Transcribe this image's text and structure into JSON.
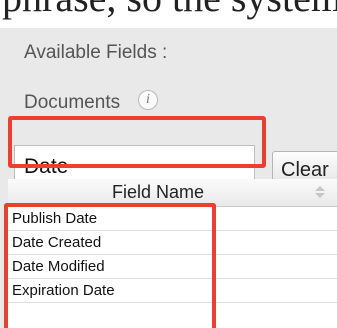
{
  "top_text": "phrase, so the system",
  "panel": {
    "available_fields_label": "Available Fields :",
    "module_label": "Documents",
    "info_icon_glyph": "i"
  },
  "search": {
    "value": "Date",
    "clear_label": "Clear"
  },
  "table": {
    "header": "Field Name",
    "rows": [
      "Publish Date",
      "Date Created",
      "Date Modified",
      "Expiration Date"
    ]
  },
  "colors": {
    "highlight": "#e8412f",
    "panel_bg": "#e9e9e9"
  }
}
